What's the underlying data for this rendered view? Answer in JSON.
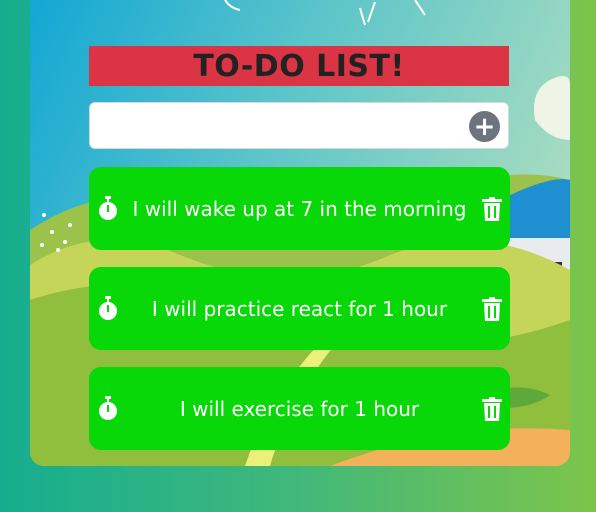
{
  "header": {
    "title": "TO-DO LIST!"
  },
  "input": {
    "value": "",
    "placeholder": ""
  },
  "add_button": {
    "icon": "plus-circle-icon",
    "label": "+"
  },
  "todos": [
    {
      "text": "I will wake up at 7 in the morning",
      "left_icon": "stopwatch-icon",
      "right_icon": "trash-icon"
    },
    {
      "text": "I will practice react for 1 hour",
      "left_icon": "stopwatch-icon",
      "right_icon": "trash-icon"
    },
    {
      "text": "I will exercise for 1 hour",
      "left_icon": "stopwatch-icon",
      "right_icon": "trash-icon"
    }
  ],
  "colors": {
    "title_bar": "#db3444",
    "todo_item": "#08d808",
    "add_button": "#6c757d",
    "page_gradient_start": "#15ad8f",
    "page_gradient_end": "#7dc54a"
  }
}
